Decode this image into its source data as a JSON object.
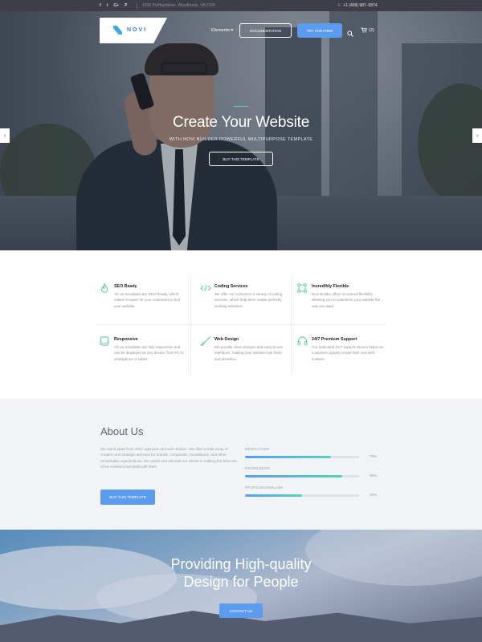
{
  "topbar": {
    "social": [
      "f",
      "t",
      "G+",
      "P"
    ],
    "address": "4336 Purthumbree, Woodbrook, VA 2235",
    "phone": "+1 (409) 987–5874"
  },
  "nav": {
    "logo_text": "NOVI",
    "elements_label": "Elements",
    "documentation_label": "DOCUMENTATION",
    "try_label": "TRY FOR FREE",
    "cart_label": "(2)"
  },
  "hero": {
    "title": "Create Your Website",
    "subtitle": "WITH NOVI BUILDER POWERFUL MULTIPURPOSE TEMPLATE",
    "button_label": "BUY THIS TEMPLATE"
  },
  "features": [
    {
      "icon": "flame-icon",
      "title": "SEO Ready",
      "desc": "All our templates are SEO Ready, which makes it easier for your customers to find your website."
    },
    {
      "icon": "code-icon",
      "title": "Coding Services",
      "desc": "We offer our customers a variety of coding services, which help them create perfectly working websites."
    },
    {
      "icon": "vector-square-icon",
      "title": "Incredibly Flexible",
      "desc": "Novi Builder offers increased flexibility, allowing you to customize your website the way you want."
    },
    {
      "icon": "tablet-icon",
      "title": "Responsive",
      "desc": "All our templates are fully responsive and can be displayed on any device, from PC to smartphone or tablet."
    },
    {
      "icon": "brush-icon",
      "title": "Web Design",
      "desc": "We provide clean designs and easy-to-use interfaces, making your website look fresh and attractive."
    },
    {
      "icon": "headset-icon",
      "title": "24/7 Premium Support",
      "desc": "Our dedicated 24/7 support service helps our customers quickly create their own web solution."
    }
  ],
  "about": {
    "title": "About Us",
    "text": "We stand apart from other agencies and web studios. We offer a wide array of creative and strategic services for brands, companies, foundations, and other remarkable organizations. We assist and educate our clients in making the best use of the solutions we build with them.",
    "button_label": "BUY THIS TEMPLATE",
    "skills": [
      {
        "label": "DEDICATION",
        "percent": 75,
        "percent_label": "75%"
      },
      {
        "label": "KNOWLEDGE",
        "percent": 85,
        "percent_label": "85%"
      },
      {
        "label": "PROFESSIONALISM",
        "percent": 50,
        "percent_label": "50%"
      }
    ]
  },
  "cta": {
    "title_line1": "Providing High-quality",
    "title_line2": "Design for People",
    "button_label": "CONTACT US"
  },
  "colors": {
    "accent": "#5b9cf0",
    "teal": "#57d3b5",
    "topbar": "#3c3f48"
  }
}
